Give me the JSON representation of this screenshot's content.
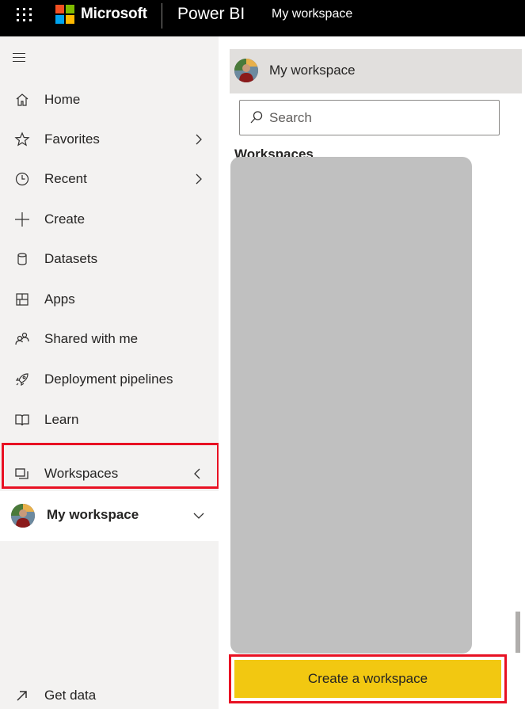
{
  "topbar": {
    "brand": "Microsoft",
    "product": "Power BI",
    "breadcrumb": "My workspace",
    "logo_colors": [
      "#f25022",
      "#7fba00",
      "#00a4ef",
      "#ffb900"
    ]
  },
  "nav": {
    "items": [
      {
        "label": "Home",
        "icon": "home-icon"
      },
      {
        "label": "Favorites",
        "icon": "star-icon"
      },
      {
        "label": "Recent",
        "icon": "clock-icon"
      },
      {
        "label": "Create",
        "icon": "plus-icon"
      },
      {
        "label": "Datasets",
        "icon": "database-icon"
      },
      {
        "label": "Apps",
        "icon": "apps-icon"
      },
      {
        "label": "Shared with me",
        "icon": "people-icon"
      },
      {
        "label": "Deployment pipelines",
        "icon": "rocket-icon"
      },
      {
        "label": "Learn",
        "icon": "book-icon"
      },
      {
        "label": "Workspaces",
        "icon": "workspaces-icon"
      }
    ],
    "my_workspace": "My workspace",
    "get_data": "Get data"
  },
  "flyout": {
    "header_title": "My workspace",
    "search_placeholder": "Search",
    "section_heading": "Workspaces",
    "create_button": "Create a workspace"
  },
  "colors": {
    "accent_yellow": "#f2c811",
    "highlight_red": "#e81123",
    "nav_bg": "#f3f2f1",
    "topbar_bg": "#000000"
  }
}
